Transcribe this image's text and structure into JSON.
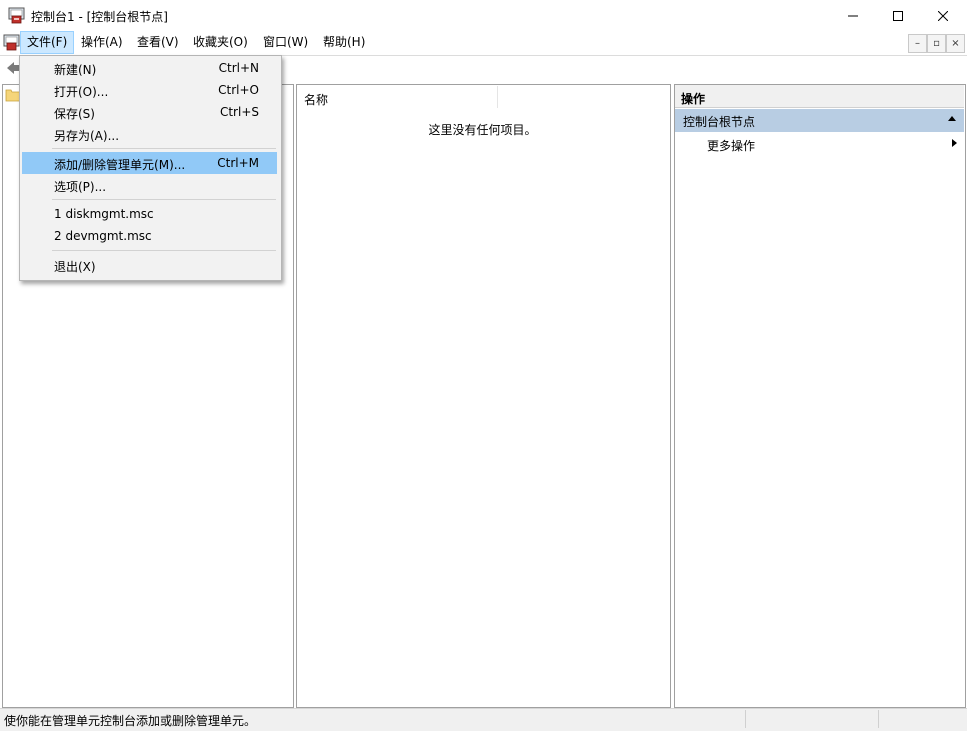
{
  "window": {
    "title": "控制台1 - [控制台根节点]",
    "controls": {
      "minimize": "—",
      "maximize": "☐",
      "close": "✕"
    }
  },
  "menubar": {
    "items": [
      "文件(F)",
      "操作(A)",
      "查看(V)",
      "收藏夹(O)",
      "窗口(W)",
      "帮助(H)"
    ],
    "mdi_buttons": {
      "minimize": "–",
      "restore": "▫",
      "close": "×"
    }
  },
  "file_menu": {
    "new": {
      "label": "新建(N)",
      "shortcut": "Ctrl+N"
    },
    "open": {
      "label": "打开(O)...",
      "shortcut": "Ctrl+O"
    },
    "save": {
      "label": "保存(S)",
      "shortcut": "Ctrl+S"
    },
    "save_as": {
      "label": "另存为(A)..."
    },
    "add_remove": {
      "label": "添加/删除管理单元(M)...",
      "shortcut": "Ctrl+M"
    },
    "options": {
      "label": "选项(P)..."
    },
    "recent_1": {
      "label": "1 diskmgmt.msc"
    },
    "recent_2": {
      "label": "2 devmgmt.msc"
    },
    "exit": {
      "label": "退出(X)"
    }
  },
  "center_pane": {
    "column_name": "名称",
    "empty_message": "这里没有任何项目。"
  },
  "actions_pane": {
    "title": "操作",
    "section": "控制台根节点",
    "more_actions": "更多操作"
  },
  "statusbar": {
    "text": "使你能在管理单元控制台添加或删除管理单元。"
  },
  "colors": {
    "highlight": "#91c9f7",
    "menu_active": "#cce8ff",
    "section_bar": "#b8cde3"
  }
}
